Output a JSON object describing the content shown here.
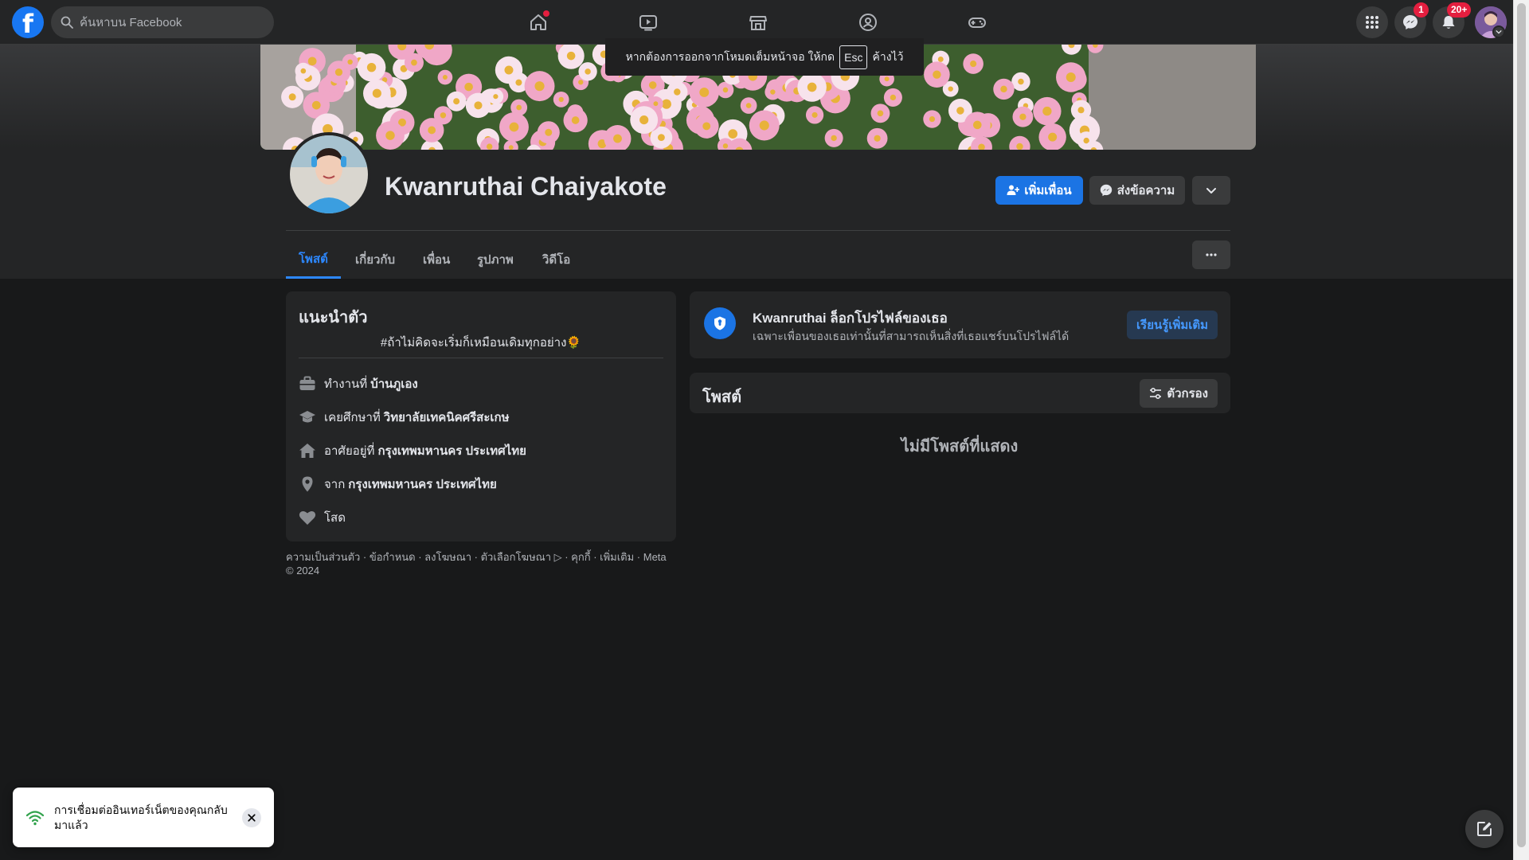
{
  "topbar": {
    "logo": "f",
    "search_placeholder": "ค้นหาบน Facebook",
    "messenger_badge": "1",
    "notifications_badge": "20+"
  },
  "fullscreen_tip": {
    "before": "หากต้องการออกจากโหมดเต็มหน้าจอ ให้กด",
    "key": "Esc",
    "after": "ค้างไว้"
  },
  "profile": {
    "name": "Kwanruthai Chaiyakote",
    "add_friend_label": "เพิ่มเพื่อน",
    "message_label": "ส่งข้อความ"
  },
  "tabs": [
    {
      "label": "โพสต์",
      "active": true
    },
    {
      "label": "เกี่ยวกับ",
      "active": false
    },
    {
      "label": "เพื่อน",
      "active": false
    },
    {
      "label": "รูปภาพ",
      "active": false
    },
    {
      "label": "วิดีโอ",
      "active": false
    }
  ],
  "intro": {
    "title": "แนะนำตัว",
    "bio": "#ถ้าไม่คิดจะเริ่มก็เหมือนเดิมทุกอย่าง🌻",
    "work_prefix": "ทำงานที่",
    "work_value": "บ้านภูเอง",
    "study_prefix": "เคยศึกษาที่",
    "study_value": "วิทยาลัยเทคนิคศรีสะเกษ",
    "lives_prefix": "อาศัยอยู่ที่",
    "lives_value": "กรุงเทพมหานคร ประเทศไทย",
    "from_prefix": "จาก",
    "from_value": "กรุงเทพมหานคร ประเทศไทย",
    "relationship": "โสด"
  },
  "footer": {
    "links": "ความเป็นส่วนตัว · ข้อกำหนด · ลงโฆษณา · ตัวเลือกโฆษณา ▷ · คุกกี้ · เพิ่มเติม · Meta",
    "copyright": "© 2024"
  },
  "locked_notice": {
    "title": "Kwanruthai ล็อกโปรไฟล์ของเธอ",
    "subtitle": "เฉพาะเพื่อนของเธอเท่านั้นที่สามารถเห็นสิ่งที่เธอแชร์บนโปรไฟล์ได้",
    "learn_more": "เรียนรู้เพิ่มเติม"
  },
  "posts": {
    "title": "โพสต์",
    "filter_label": "ตัวกรอง",
    "empty_text": "ไม่มีโพสต์ที่แสดง"
  },
  "toast": {
    "text": "การเชื่อมต่ออินเทอร์เน็ตของคุณกลับมาแล้ว"
  },
  "colors": {
    "accent": "#1b74e4",
    "link": "#2d88ff",
    "background": "#18191a",
    "card": "#242526"
  },
  "icons": [
    "search-icon",
    "home-icon",
    "watch-icon",
    "marketplace-icon",
    "groups-icon",
    "gaming-icon",
    "menu-grid-icon",
    "messenger-icon",
    "bell-icon",
    "add-friend-icon",
    "chevron-down-icon",
    "more-icon",
    "briefcase-icon",
    "graduation-cap-icon",
    "house-icon",
    "location-pin-icon",
    "heart-icon",
    "shield-lock-icon",
    "filter-icon",
    "wifi-icon",
    "close-icon",
    "compose-icon"
  ]
}
